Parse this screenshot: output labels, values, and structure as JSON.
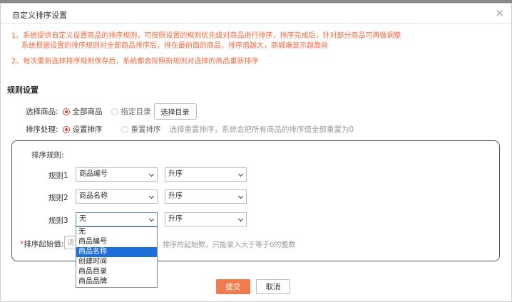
{
  "dialog": {
    "title": "自定义排序设置",
    "close_glyph": "×"
  },
  "notes": {
    "line1": "1、系统提供自定义设置商品的排序规则，可按照设置的规则优先级对商品进行排序，排序完成后，针对部分商品可再做调整",
    "line2": "系统根据设置的排序规则对全部商品排序后，排在最前面的商品，排序值越大，商城端显示越靠前",
    "line3": "2、每次重新选择排序规则保存后，系统都会按照新规则对选择的商品重新排序"
  },
  "section_title": "规则设置",
  "select_goods": {
    "label": "选择商品:",
    "option_all": "全部商品",
    "option_dir": "指定目录",
    "choose_button": "选择目录",
    "selected": "全部商品"
  },
  "sort_process": {
    "label": "排序处理:",
    "option_set": "设置排序",
    "option_reset": "重置排序",
    "hint": "选择重置排序，系统会把所有商品的排序值全部重置为0",
    "selected": "设置排序"
  },
  "rules": {
    "header": "排序规则:",
    "items": [
      {
        "label": "规则1",
        "field": "商品编号",
        "order": "升序"
      },
      {
        "label": "规则2",
        "field": "商品名称",
        "order": "升序"
      },
      {
        "label": "规则3",
        "field": "无",
        "order": "升序"
      }
    ]
  },
  "dropdown": {
    "options": [
      "无",
      "商品编号",
      "商品名称",
      "创建时间",
      "商品目录",
      "商品品牌"
    ],
    "highlighted": "商品名称"
  },
  "start_value": {
    "label": "排序起始值:",
    "required_mark": "*",
    "placeholder": "请",
    "hint": "排序的起始数，只能录入大于等于0的整数"
  },
  "footer": {
    "submit": "提交",
    "cancel": "取消"
  },
  "colors": {
    "accent": "#f07b4e",
    "note_text": "#f2683e",
    "radio_on": "#e8392c",
    "dropdown_highlight": "#1e6fd9"
  }
}
